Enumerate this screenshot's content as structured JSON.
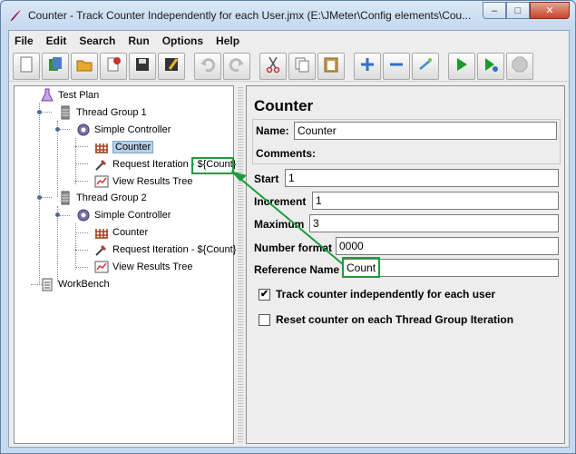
{
  "window": {
    "title": "Counter - Track Counter Independently for each User.jmx (E:\\JMeter\\Config elements\\Cou...",
    "minimize": "–",
    "maximize": "□",
    "close": "✕"
  },
  "menu": {
    "file": "File",
    "edit": "Edit",
    "search": "Search",
    "run": "Run",
    "options": "Options",
    "help": "Help"
  },
  "toolbar": {
    "icons": [
      "new-icon",
      "templates-icon",
      "open-icon",
      "close-icon",
      "save-icon",
      "save-as-icon",
      "undo-icon",
      "redo-icon",
      "cut-icon",
      "copy-icon",
      "paste-icon",
      "expand-icon",
      "collapse-icon",
      "toggle-icon",
      "start-icon",
      "start-no-pause-icon",
      "stop-icon"
    ]
  },
  "tree": {
    "test_plan": "Test Plan",
    "thread_group_1": "Thread Group 1",
    "simple_controller_1": "Simple Controller",
    "counter_1": "Counter",
    "request_iteration_1": "Request Iteration - ",
    "request_iteration_1_var": "${Count}",
    "view_results_tree_1": "View Results Tree",
    "thread_group_2": "Thread Group 2",
    "simple_controller_2": "Simple Controller",
    "counter_2": "Counter",
    "request_iteration_2": "Request Iteration - ${Count}",
    "view_results_tree_2": "View Results Tree",
    "workbench": "WorkBench"
  },
  "form": {
    "title": "Counter",
    "name_label": "Name:",
    "name_value": "Counter",
    "comments_label": "Comments:",
    "start_label": "Start",
    "start_value": "1",
    "increment_label": "Increment",
    "increment_value": "1",
    "maximum_label": "Maximum",
    "maximum_value": "3",
    "number_format_label": "Number format",
    "number_format_value": "0000",
    "reference_name_label": "Reference Name",
    "reference_name_value": "Count",
    "track_independently_label": "Track counter independently for each user",
    "track_independently_checked": true,
    "reset_label": "Reset counter on each Thread Group Iteration",
    "reset_checked": false
  },
  "colors": {
    "highlight": "#1f9c3e",
    "selection": "#b8cfe5"
  }
}
